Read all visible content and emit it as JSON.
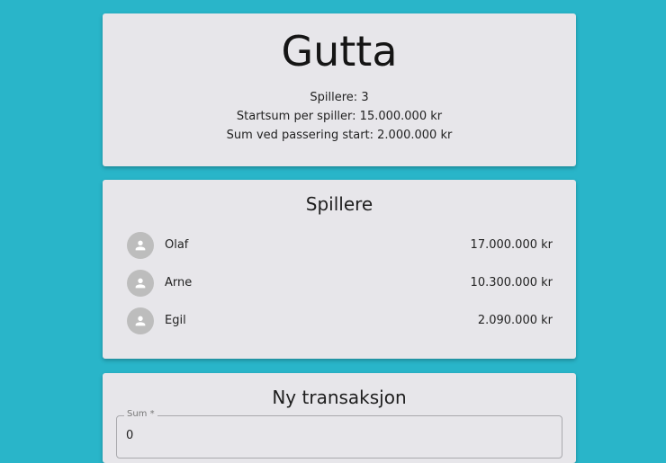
{
  "game": {
    "title": "Gutta",
    "players_line": "Spillere: 3",
    "start_sum_line": "Startsum per spiller: 15.000.000 kr",
    "pass_start_line": "Sum ved passering start: 2.000.000 kr"
  },
  "players_section": {
    "title": "Spillere",
    "players": [
      {
        "name": "Olaf",
        "balance": "17.000.000 kr",
        "avatar_icon": "person-icon"
      },
      {
        "name": "Arne",
        "balance": "10.300.000 kr",
        "avatar_icon": "person-icon"
      },
      {
        "name": "Egil",
        "balance": "2.090.000 kr",
        "avatar_icon": "person-icon"
      }
    ]
  },
  "transaction": {
    "title": "Ny transaksjon",
    "sum_label": "Sum *",
    "sum_value": "0"
  },
  "colors": {
    "background": "#29b5c9",
    "card": "#e7e6ea",
    "avatar": "#bdbdbd"
  }
}
